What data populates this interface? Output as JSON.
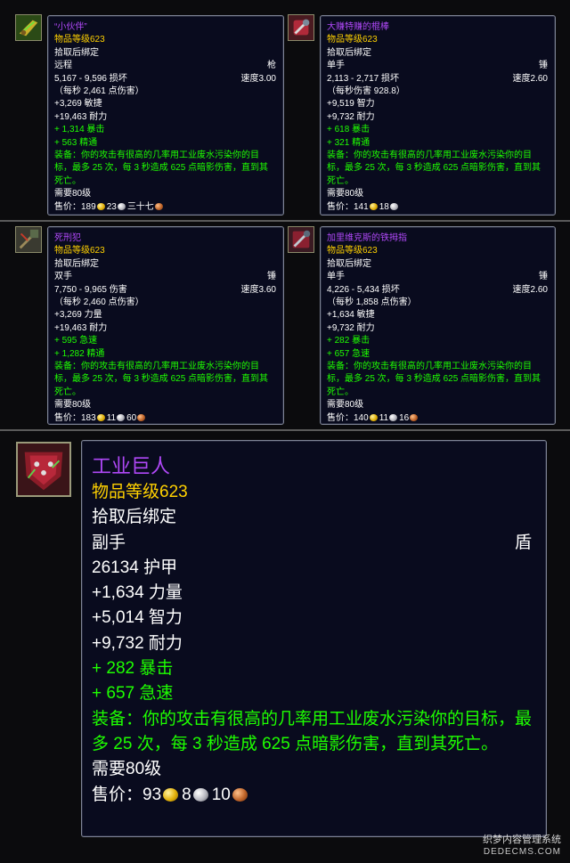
{
  "items": [
    {
      "name": "“小伙伴”",
      "ilvl": "物品等级623",
      "bind": "拾取后绑定",
      "slot": "远程",
      "type": "枪",
      "damage": "5,167 - 9,596 损坏",
      "speed": "速度3.00",
      "dps": "（每秒 2,461 点伤害）",
      "stats": [
        "+3,269 敏捷",
        "+19,463 耐力"
      ],
      "green": [
        "+ 1,314 暴击",
        "+ 563 精通"
      ],
      "equip": "装备：你的攻击有很高的几率用工业废水污染你的目标，最多 25 次，每 3 秒造成 625 点暗影伤害，直到其死亡。",
      "req": "需要80级",
      "sell_label": "售价：",
      "gold": "189",
      "silver": "23",
      "copper": "三十七",
      "icon": "gun-icon"
    },
    {
      "name": "大赚特赚的棍棒",
      "ilvl": "物品等级623",
      "bind": "拾取后绑定",
      "slot": "单手",
      "type": "锤",
      "damage": "2,113 - 2,717 损坏",
      "speed": "速度2.60",
      "dps": "（每秒伤害 928.8）",
      "stats": [
        "+9,519 智力",
        "+9,732 耐力"
      ],
      "green": [
        "+ 618 暴击",
        "+ 321 精通"
      ],
      "equip": "装备：你的攻击有很高的几率用工业废水污染你的目标，最多 25 次，每 3 秒造成 625 点暗影伤害，直到其死亡。",
      "req": "需要80级",
      "sell_label": "售价：",
      "gold": "141",
      "silver": "18",
      "copper": "",
      "icon": "mace-icon"
    },
    {
      "name": "死刑犯",
      "ilvl": "物品等级623",
      "bind": "拾取后绑定",
      "slot": "双手",
      "type": "锤",
      "damage": "7,750 - 9,965 伤害",
      "speed": "速度3.60",
      "dps": "（每秒 2,460 点伤害）",
      "stats": [
        "+3,269 力量",
        "+19,463 耐力"
      ],
      "green": [
        "+ 595 急速",
        "+ 1,282 精通"
      ],
      "equip": "装备：你的攻击有很高的几率用工业废水污染你的目标，最多 25 次，每 3 秒造成 625 点暗影伤害，直到其死亡。",
      "req": "需要80级",
      "sell_label": "售价：",
      "gold": "183",
      "silver": "11",
      "copper": "60",
      "icon": "two-hand-mace-icon"
    },
    {
      "name": "加里维克斯的铁拇指",
      "ilvl": "物品等级623",
      "bind": "拾取后绑定",
      "slot": "单手",
      "type": "锤",
      "damage": "4,226 - 5,434 损坏",
      "speed": "速度2.60",
      "dps": "（每秒 1,858 点伤害）",
      "stats": [
        "+1,634 敏捷",
        "+9,732 耐力"
      ],
      "green": [
        "+ 282 暴击",
        "+ 657 急速"
      ],
      "equip": "装备：你的攻击有很高的几率用工业废水污染你的目标，最多 25 次，每 3 秒造成 625 点暗影伤害，直到其死亡。",
      "req": "需要80级",
      "sell_label": "售价：",
      "gold": "140",
      "silver": "11",
      "copper": "16",
      "icon": "fist-mace-icon"
    }
  ],
  "shield": {
    "name": "工业巨人",
    "ilvl": "物品等级623",
    "bind": "拾取后绑定",
    "slot": "副手",
    "type": "盾",
    "armor": "26134 护甲",
    "stats": [
      "+1,634 力量",
      "+5,014 智力",
      "+9,732 耐力"
    ],
    "green": [
      "+ 282 暴击",
      "+ 657 急速"
    ],
    "equip": "装备：你的攻击有很高的几率用工业废水污染你的目标，最多 25 次，每 3 秒造成 625 点暗影伤害，直到其死亡。",
    "req": "需要80级",
    "sell_label": "售价：",
    "gold": "93",
    "silver": "8",
    "copper": "10",
    "icon": "shield-icon"
  },
  "watermark": {
    "line1": "织梦内容管理系统",
    "line2": "DEDECMS.COM"
  },
  "colors": {
    "item_name": "#b048f8",
    "item_level": "#ffd100",
    "stat_green": "#1eff00",
    "tooltip_bg": "#090b1e"
  }
}
